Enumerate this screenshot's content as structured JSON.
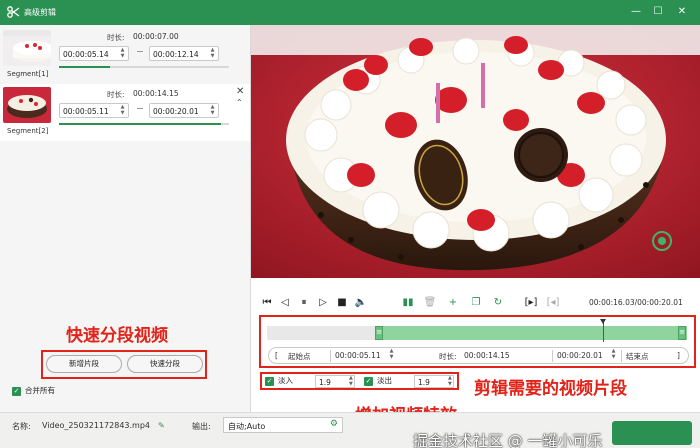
{
  "window": {
    "title": "高级剪辑",
    "minimize": "—",
    "maximize": "☐",
    "close": "✕"
  },
  "segments": [
    {
      "label": "Segment[1]",
      "duration_label": "时长:",
      "duration": "00:00:07.00",
      "start": "00:00:05.14",
      "end": "00:00:12.14",
      "progress": 0.3
    },
    {
      "label": "Segment[2]",
      "duration_label": "时长:",
      "duration": "00:00:14.15",
      "start": "00:00:05.11",
      "end": "00:00:20.01",
      "progress": 0.95
    }
  ],
  "left_actions": {
    "add_segment": "新增片段",
    "quick_split": "快速分段",
    "merge_all": "合并所有"
  },
  "annotations": {
    "quick_split_video": "快速分段视频",
    "clip_needed": "剪辑需要的视频片段",
    "add_effects": "增加视频特效"
  },
  "player": {
    "timecode": "00:00:16.03/00:00:20.01"
  },
  "trim": {
    "start_point": "起始点",
    "start_time": "00:00:05.11",
    "duration_label": "时长:",
    "duration": "00:00:14.15",
    "end_time": "00:00:20.01",
    "end_point": "结束点",
    "selection_start": 0.26,
    "selection_end": 1.0,
    "playhead": 0.8
  },
  "effects": {
    "fade_in_label": "淡入",
    "fade_in_value": "1.9",
    "fade_out_label": "淡出",
    "fade_out_value": "1.9"
  },
  "footer": {
    "name_label": "名称:",
    "file_name": "Video_250321172843.mp4",
    "output_label": "输出:",
    "output_value": "自动;Auto",
    "watermark": "掘金技术社区 @ 一罐小可乐"
  },
  "colors": {
    "brand_green": "#2a9152",
    "annotation_red": "#e2231a"
  }
}
